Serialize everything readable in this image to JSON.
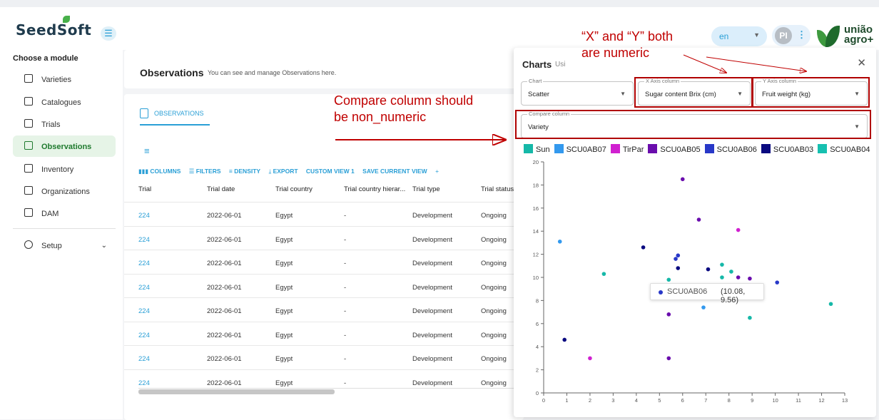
{
  "header": {
    "logo": "SeedSoft",
    "lang": "en",
    "avatar": "PI",
    "brand_line1": "união",
    "brand_line2": "agro+"
  },
  "sidebar": {
    "title": "Choose a module",
    "items": [
      {
        "label": "Varieties"
      },
      {
        "label": "Catalogues"
      },
      {
        "label": "Trials"
      },
      {
        "label": "Observations"
      },
      {
        "label": "Inventory"
      },
      {
        "label": "Organizations"
      },
      {
        "label": "DAM"
      },
      {
        "label": "Setup"
      }
    ]
  },
  "main": {
    "title": "Observations",
    "subtitle": "You can see and manage Observations here.",
    "tab": "OBSERVATIONS",
    "toolbar": [
      "COLUMNS",
      "FILTERS",
      "DENSITY",
      "EXPORT",
      "CUSTOM VIEW 1",
      "SAVE CURRENT VIEW",
      "+"
    ],
    "columns": [
      "Trial",
      "Trial date",
      "Trial country",
      "Trial country hierar...",
      "Trial type",
      "Trial status"
    ],
    "rows": [
      [
        "224",
        "2022-06-01",
        "Egypt",
        "-",
        "Development",
        "Ongoing"
      ],
      [
        "224",
        "2022-06-01",
        "Egypt",
        "-",
        "Development",
        "Ongoing"
      ],
      [
        "224",
        "2022-06-01",
        "Egypt",
        "-",
        "Development",
        "Ongoing"
      ],
      [
        "224",
        "2022-06-01",
        "Egypt",
        "-",
        "Development",
        "Ongoing"
      ],
      [
        "224",
        "2022-06-01",
        "Egypt",
        "-",
        "Development",
        "Ongoing"
      ],
      [
        "224",
        "2022-06-01",
        "Egypt",
        "-",
        "Development",
        "Ongoing"
      ],
      [
        "224",
        "2022-06-01",
        "Egypt",
        "-",
        "Development",
        "Ongoing"
      ],
      [
        "224",
        "2022-06-01",
        "Egypt",
        "-",
        "Development",
        "Ongoing"
      ]
    ]
  },
  "charts": {
    "title": "Charts",
    "subtitle": "Usi",
    "chart": {
      "label": "Chart",
      "value": "Scatter"
    },
    "x_axis": {
      "label": "X Axis column",
      "value": "Sugar content Brix (cm)"
    },
    "y_axis": {
      "label": "Y Axis column",
      "value": "Fruit weight (kg)"
    },
    "compare": {
      "label": "Compare column",
      "value": "Variety"
    },
    "tooltip": {
      "name": "SCU0AB06",
      "value": "(10.08, 9.56)",
      "color": "#2838c8"
    }
  },
  "annotations": {
    "xy_note_line1": "“X” and “Y” both",
    "xy_note_line2": "are numeric",
    "compare_note_line1": "Compare column should",
    "compare_note_line2": "be non_numeric"
  },
  "chart_data": {
    "type": "scatter",
    "xlim": [
      0,
      13
    ],
    "ylim": [
      0,
      20
    ],
    "x_ticks": [
      0,
      1,
      2,
      3,
      4,
      5,
      6,
      7,
      8,
      9,
      10,
      11,
      12,
      13
    ],
    "y_ticks": [
      0,
      2,
      4,
      6,
      8,
      10,
      12,
      14,
      16,
      18,
      20
    ],
    "legend_position": "top",
    "series": [
      {
        "name": "Sun",
        "color": "#16b8a8",
        "points": [
          [
            2.6,
            10.3
          ],
          [
            5.4,
            9.8
          ],
          [
            7.7,
            10.0
          ],
          [
            7.7,
            11.1
          ],
          [
            8.1,
            10.5
          ],
          [
            8.9,
            6.5
          ],
          [
            12.4,
            7.7
          ]
        ]
      },
      {
        "name": "SCU0AB07",
        "color": "#3399ee",
        "points": [
          [
            0.7,
            13.1
          ],
          [
            6.9,
            7.4
          ]
        ]
      },
      {
        "name": "TirPar",
        "color": "#d020d0",
        "points": [
          [
            2.0,
            3.0
          ],
          [
            8.4,
            14.1
          ]
        ]
      },
      {
        "name": "SCU0AB05",
        "color": "#6a0dad",
        "points": [
          [
            5.4,
            6.8
          ],
          [
            5.4,
            3.0
          ],
          [
            6.0,
            18.5
          ],
          [
            6.7,
            15.0
          ],
          [
            8.4,
            10.0
          ],
          [
            8.9,
            9.9
          ]
        ]
      },
      {
        "name": "SCU0AB06",
        "color": "#2838c8",
        "points": [
          [
            5.7,
            11.6
          ],
          [
            5.8,
            11.9
          ],
          [
            10.08,
            9.56
          ]
        ]
      },
      {
        "name": "SCU0AB03",
        "color": "#0a0a80",
        "points": [
          [
            0.9,
            4.6
          ],
          [
            4.3,
            12.6
          ],
          [
            5.8,
            10.8
          ],
          [
            7.1,
            10.7
          ]
        ]
      },
      {
        "name": "SCU0AB04",
        "color": "#16c0b0",
        "points": []
      }
    ]
  }
}
